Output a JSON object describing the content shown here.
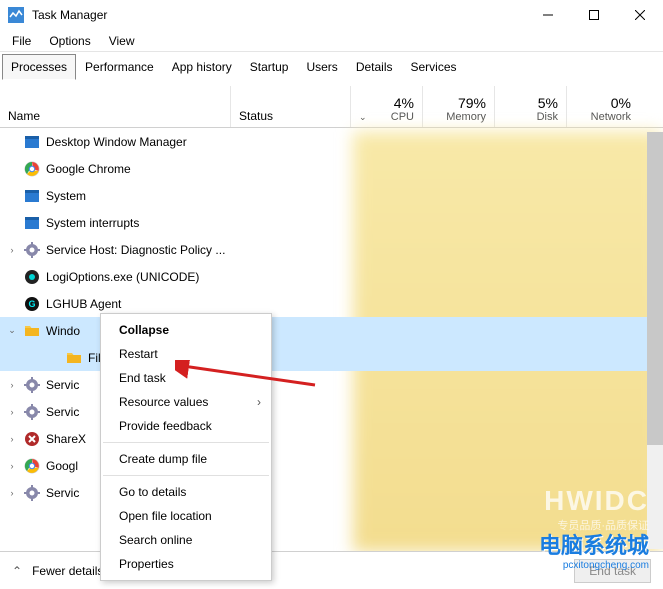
{
  "window": {
    "title": "Task Manager"
  },
  "menubar": {
    "items": [
      "File",
      "Options",
      "View"
    ]
  },
  "tabs": {
    "items": [
      "Processes",
      "Performance",
      "App history",
      "Startup",
      "Users",
      "Details",
      "Services"
    ],
    "active": 0
  },
  "columns": {
    "name": "Name",
    "status": "Status",
    "cpu": {
      "pct": "4%",
      "label": "CPU"
    },
    "memory": {
      "pct": "79%",
      "label": "Memory"
    },
    "disk": {
      "pct": "5%",
      "label": "Disk"
    },
    "network": {
      "pct": "0%",
      "label": "Network"
    }
  },
  "processes": [
    {
      "expander": "",
      "icon": "window-icon",
      "name": "Desktop Window Manager"
    },
    {
      "expander": "",
      "icon": "chrome-icon",
      "name": "Google Chrome"
    },
    {
      "expander": "",
      "icon": "window-icon",
      "name": "System"
    },
    {
      "expander": "",
      "icon": "window-icon",
      "name": "System interrupts"
    },
    {
      "expander": ">",
      "icon": "gear-icon",
      "name": "Service Host: Diagnostic Policy ..."
    },
    {
      "expander": "",
      "icon": "logi-icon",
      "name": "LogiOptions.exe (UNICODE)"
    },
    {
      "expander": "",
      "icon": "lghub-icon",
      "name": "LGHUB Agent"
    },
    {
      "expander": "v",
      "icon": "folder-icon",
      "name": "Windo",
      "selected": true
    },
    {
      "expander": "",
      "icon": "folder-icon",
      "name": "File",
      "child": true,
      "selected": true
    },
    {
      "expander": ">",
      "icon": "gear-icon",
      "name": "Servic"
    },
    {
      "expander": ">",
      "icon": "gear-icon",
      "name": "Servic"
    },
    {
      "expander": ">",
      "icon": "sharex-icon",
      "name": "ShareX"
    },
    {
      "expander": ">",
      "icon": "chrome-icon",
      "name": "Googl"
    },
    {
      "expander": ">",
      "icon": "gear-icon",
      "name": "Servic"
    }
  ],
  "context_menu": {
    "items": [
      {
        "label": "Collapse",
        "bold": true
      },
      {
        "label": "Restart"
      },
      {
        "label": "End task"
      },
      {
        "label": "Resource values",
        "submenu": true
      },
      {
        "label": "Provide feedback"
      },
      {
        "sep": true
      },
      {
        "label": "Create dump file"
      },
      {
        "sep": true
      },
      {
        "label": "Go to details"
      },
      {
        "label": "Open file location"
      },
      {
        "label": "Search online"
      },
      {
        "label": "Properties"
      }
    ]
  },
  "footer": {
    "fewer_details": "Fewer details",
    "end_task": "End task"
  },
  "watermark": {
    "line1": "HWIDC",
    "line2": "专员品质·品质保证",
    "line3": "电脑系统城",
    "line4": "pcxitongcheng.com"
  }
}
